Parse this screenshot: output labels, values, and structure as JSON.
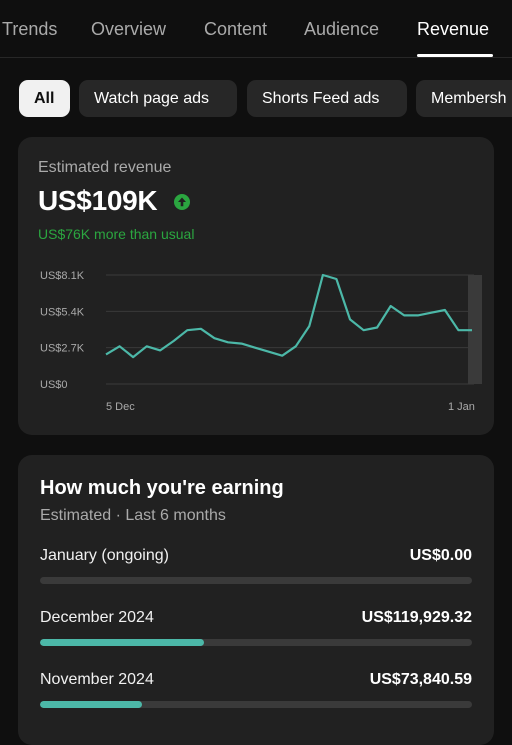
{
  "tabs": [
    {
      "label": "Trends",
      "active": false
    },
    {
      "label": "Overview",
      "active": false
    },
    {
      "label": "Content",
      "active": false
    },
    {
      "label": "Audience",
      "active": false
    },
    {
      "label": "Revenue",
      "active": true
    }
  ],
  "chips": [
    {
      "label": "All",
      "active": true
    },
    {
      "label": "Watch page ads",
      "active": false
    },
    {
      "label": "Shorts Feed ads",
      "active": false
    },
    {
      "label": "Membersh",
      "active": false
    }
  ],
  "revenue": {
    "label": "Estimated revenue",
    "value": "US$109K",
    "trend_icon": "arrow-up-circle-icon",
    "delta": "US$76K more than usual"
  },
  "chart_data": {
    "type": "line",
    "y_ticks": [
      "US$0",
      "US$2.7K",
      "US$5.4K",
      "US$8.1K"
    ],
    "ylim": [
      0,
      8100
    ],
    "x_tick_labels": [
      "5 Dec",
      "1 Jan"
    ],
    "x_range": [
      "2024-12-05",
      "2025-01-01"
    ],
    "x": [
      "2024-12-05",
      "2024-12-06",
      "2024-12-07",
      "2024-12-08",
      "2024-12-09",
      "2024-12-10",
      "2024-12-11",
      "2024-12-12",
      "2024-12-13",
      "2024-12-14",
      "2024-12-15",
      "2024-12-16",
      "2024-12-17",
      "2024-12-18",
      "2024-12-19",
      "2024-12-20",
      "2024-12-21",
      "2024-12-22",
      "2024-12-23",
      "2024-12-24",
      "2024-12-25",
      "2024-12-26",
      "2024-12-27",
      "2024-12-28",
      "2024-12-29",
      "2024-12-30",
      "2024-12-31",
      "2025-01-01"
    ],
    "values": [
      2200,
      2800,
      2000,
      2800,
      2500,
      3200,
      4000,
      4100,
      3400,
      3100,
      3000,
      2700,
      2400,
      2100,
      2800,
      4300,
      8100,
      7800,
      4800,
      4000,
      4200,
      5800,
      5100,
      5100,
      5300,
      5500,
      4000,
      4000
    ],
    "line_color": "#4cb8a8",
    "grid": true,
    "highlighted_last_point": true
  },
  "earnings": {
    "title": "How much you're earning",
    "subtitle": "Estimated · Last 6 months",
    "rows": [
      {
        "month": "January (ongoing)",
        "value": "US$0.00",
        "fraction": 0
      },
      {
        "month": "December 2024",
        "value": "US$119,929.32",
        "fraction": 0.38
      },
      {
        "month": "November 2024",
        "value": "US$73,840.59",
        "fraction": 0.235
      }
    ]
  }
}
